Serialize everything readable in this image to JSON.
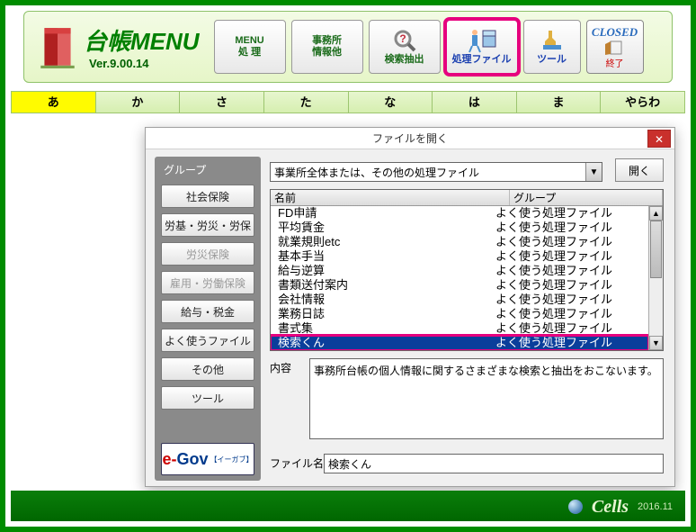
{
  "app": {
    "title": "台帳MENU",
    "version": "Ver.9.00.14"
  },
  "toolbar": {
    "menu_processing": "MENU\n処 理",
    "office_info": "事務所\n情報他",
    "search_extract": "検索抽出",
    "processing_file": "処理ファイル",
    "tool": "ツール",
    "closed": "CLOSED",
    "end": "終了"
  },
  "kana": [
    "あ",
    "か",
    "さ",
    "た",
    "な",
    "は",
    "ま",
    "やらわ"
  ],
  "kana_active_index": 0,
  "status": {
    "brand": "Cells",
    "date": "2016.11"
  },
  "dialog": {
    "title": "ファイルを開く",
    "close_label": "✕",
    "group_header": "グループ",
    "group_buttons": [
      {
        "label": "社会保険",
        "disabled": false
      },
      {
        "label": "労基・労災・労保",
        "disabled": false
      },
      {
        "label": "労災保険",
        "disabled": true
      },
      {
        "label": "雇用・労働保険",
        "disabled": true
      },
      {
        "label": "給与・税金",
        "disabled": false
      },
      {
        "label": "よく使うファイル",
        "disabled": false
      },
      {
        "label": "その他",
        "disabled": false
      },
      {
        "label": "ツール",
        "disabled": false
      }
    ],
    "combo_value": "事業所全体または、その他の処理ファイル",
    "open_btn": "開く",
    "columns": {
      "name": "名前",
      "group": "グループ"
    },
    "rows": [
      {
        "name": "FD申請",
        "group": "よく使う処理ファイル"
      },
      {
        "name": "平均賃金",
        "group": "よく使う処理ファイル"
      },
      {
        "name": "就業規則etc",
        "group": "よく使う処理ファイル"
      },
      {
        "name": "基本手当",
        "group": "よく使う処理ファイル"
      },
      {
        "name": "給与逆算",
        "group": "よく使う処理ファイル"
      },
      {
        "name": "書類送付案内",
        "group": "よく使う処理ファイル"
      },
      {
        "name": "会社情報",
        "group": "よく使う処理ファイル"
      },
      {
        "name": "業務日誌",
        "group": "よく使う処理ファイル"
      },
      {
        "name": "書式集",
        "group": "よく使う処理ファイル"
      },
      {
        "name": "検索くん",
        "group": "よく使う処理ファイル",
        "selected": true
      }
    ],
    "desc_label": "内容",
    "desc_text": "事務所台帳の個人情報に関するさまざまな検索と抽出をおこないます。",
    "fname_label": "ファイル名",
    "fname_value": "検索くん",
    "egov": {
      "e": "e-",
      "gov": "Gov",
      "sub": "【イーガブ】"
    }
  }
}
